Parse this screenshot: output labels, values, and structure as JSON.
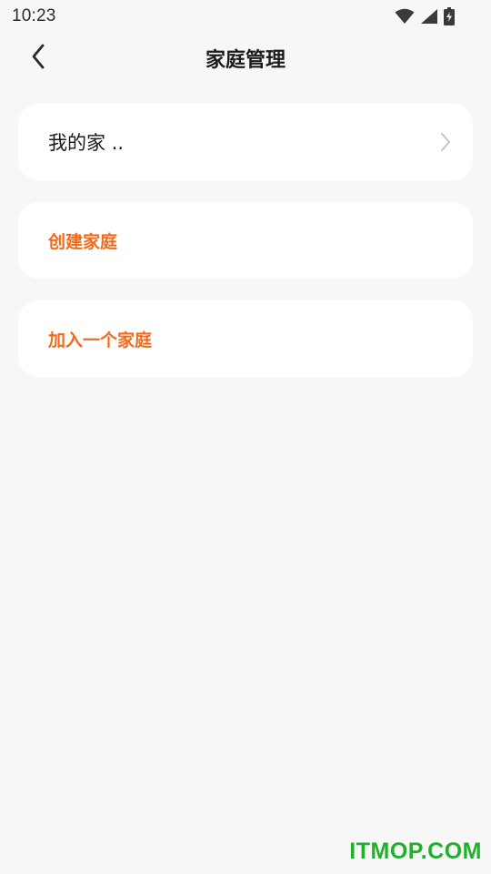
{
  "status_bar": {
    "time": "10:23",
    "icons": [
      "wifi-icon",
      "signal-icon",
      "battery-charging-icon"
    ]
  },
  "header": {
    "back_icon": "chevron-left-icon",
    "title": "家庭管理"
  },
  "home_list": [
    {
      "name": "我的家 ..",
      "icon": "chevron-right-icon"
    }
  ],
  "actions": {
    "create_label": "创建家庭",
    "join_label": "加入一个家庭"
  },
  "colors": {
    "background": "#f7f7f7",
    "card": "#ffffff",
    "accent": "#f26a1b",
    "watermark": "#22b02c"
  },
  "watermark": "ITMOP.COM"
}
